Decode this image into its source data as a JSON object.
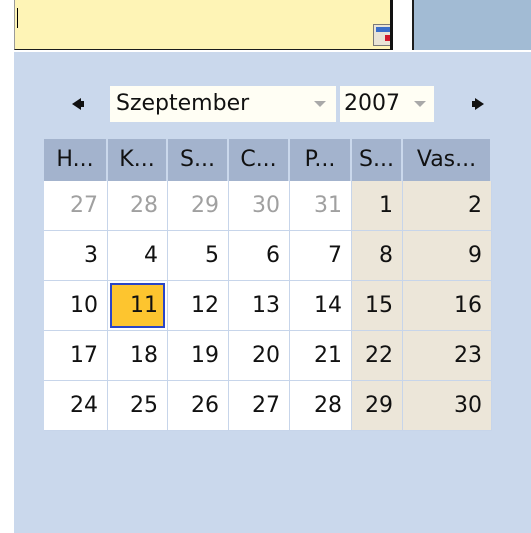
{
  "input": {
    "value": ""
  },
  "calendar": {
    "month": "Szeptember",
    "year": "2007",
    "weekdays": [
      "H...",
      "K...",
      "S...",
      "C...",
      "P...",
      "S...",
      "Vas..."
    ],
    "weeks": [
      [
        "27",
        "28",
        "29",
        "30",
        "31",
        "1",
        "2"
      ],
      [
        "3",
        "4",
        "5",
        "6",
        "7",
        "8",
        "9"
      ],
      [
        "10",
        "11",
        "12",
        "13",
        "14",
        "15",
        "16"
      ],
      [
        "17",
        "18",
        "19",
        "20",
        "21",
        "22",
        "23"
      ],
      [
        "24",
        "25",
        "26",
        "27",
        "28",
        "29",
        "30"
      ]
    ],
    "selected_day": "11"
  },
  "colors": {
    "input_bg": "#fef4b6",
    "panel_bg": "#cad8ec",
    "header_bg": "#a3b3cd",
    "weekend_bg": "#ece6d9",
    "selected_bg": "#fdc52f",
    "selected_border": "#2a46c8"
  },
  "icons": {
    "date_picker": "calendar-icon",
    "prev": "previous-month-icon",
    "next": "next-month-icon"
  }
}
